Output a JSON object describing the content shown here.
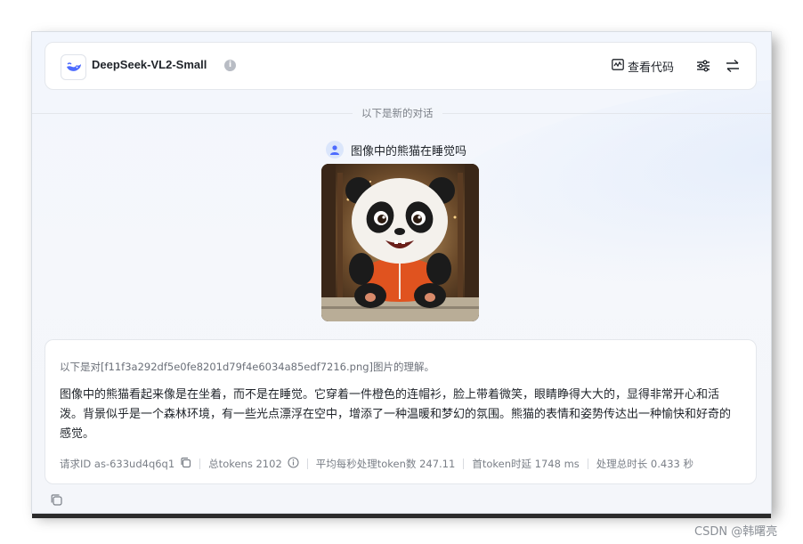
{
  "header": {
    "model_name": "DeepSeek-VL2-Small",
    "info_glyph": "i",
    "view_code_label": "查看代码",
    "icons": [
      "deepseek-whale-logo",
      "info-icon",
      "code-icon",
      "sliders-icon",
      "swap-icon"
    ]
  },
  "divider": {
    "text": "以下是新的对话"
  },
  "user_message": {
    "text": "图像中的熊猫在睡觉吗",
    "image_alt": "panda-image"
  },
  "reply": {
    "header": "以下是对[f11f3a292df5e0fe8201d79f4e6034a85edf7216.png]图片的理解。",
    "body": "图像中的熊猫看起来像是在坐着，而不是在睡觉。它穿着一件橙色的连帽衫，脸上带着微笑，眼睛睁得大大的，显得非常开心和活泼。背景似乎是一个森林环境，有一些光点漂浮在空中，增添了一种温暖和梦幻的氛围。熊猫的表情和姿势传达出一种愉快和好奇的感觉。",
    "meta": {
      "request_id": "请求ID as-633ud4q6q1",
      "total_tokens": "总tokens 2102",
      "avg_speed": "平均每秒处理token数 247.11",
      "first_token_latency": "首token时延 1748 ms",
      "total_time": "处理总时长 0.433 秒"
    }
  },
  "watermark": "CSDN @韩曙亮",
  "colors": {
    "accent": "#4d6bfe",
    "panda_jacket": "#e0531f"
  }
}
